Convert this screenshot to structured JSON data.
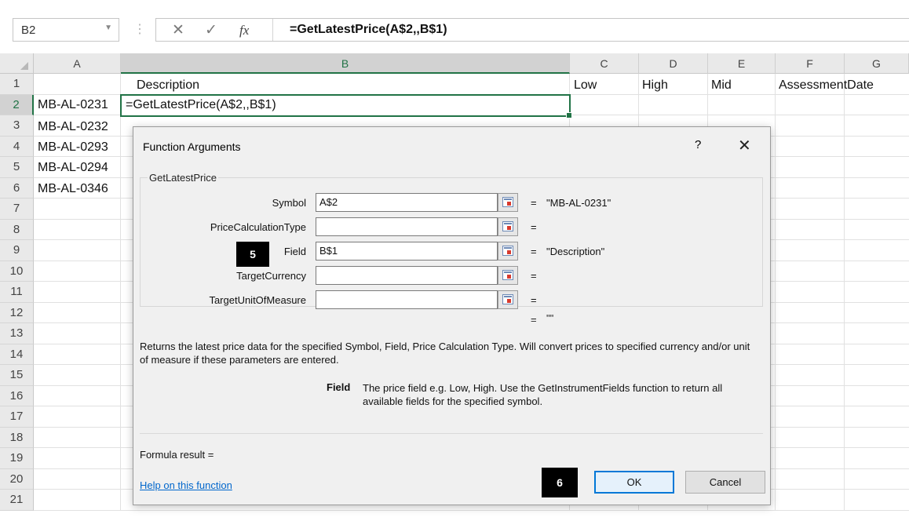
{
  "formula_bar": {
    "name_box": "B2",
    "cancel_icon": "✕",
    "enter_icon": "✓",
    "fx_icon": "fx",
    "formula": "=GetLatestPrice(A$2,,B$1)"
  },
  "sheet": {
    "columns": [
      "A",
      "B",
      "C",
      "D",
      "E",
      "F",
      "G"
    ],
    "selected_column": "B",
    "rows": [
      "1",
      "2",
      "3",
      "4",
      "5",
      "6",
      "7",
      "8",
      "9",
      "10",
      "11",
      "12",
      "13",
      "14",
      "15",
      "16",
      "17",
      "18",
      "19",
      "20",
      "21"
    ],
    "selected_row": "2",
    "header_row": {
      "B": "Description",
      "C": "Low",
      "D": "High",
      "E": "Mid",
      "F": "AssessmentDate"
    },
    "symbols": [
      "MB-AL-0231",
      "MB-AL-0232",
      "MB-AL-0293",
      "MB-AL-0294",
      "MB-AL-0346"
    ],
    "active_cell_text": "=GetLatestPrice(A$2,,B$1)",
    "grid_line_color": "#e1e1e1",
    "selection_color": "#217346"
  },
  "dialog": {
    "title": "Function Arguments",
    "help_icon": "?",
    "close_icon": "✕",
    "function_name": "GetLatestPrice",
    "args": [
      {
        "label": "Symbol",
        "value": "A$2",
        "result": "\"MB-AL-0231\""
      },
      {
        "label": "PriceCalculationType",
        "value": "",
        "result": ""
      },
      {
        "label": "Field",
        "value": "B$1",
        "result": "\"Description\""
      },
      {
        "label": "TargetCurrency",
        "value": "",
        "result": ""
      },
      {
        "label": "TargetUnitOfMeasure",
        "value": "",
        "result": ""
      }
    ],
    "eq_sign": "=",
    "overall_result": "\"\"",
    "description": "Returns the latest price data for the specified Symbol, Field, Price Calculation Type. Will convert prices to specified currency and/or unit of measure if these parameters are entered.",
    "field_name": "Field",
    "field_description": "The price field e.g. Low, High. Use the GetInstrumentFields function to return all available fields for the specified symbol.",
    "formula_result_label": "Formula result =",
    "help_link": "Help on this function",
    "ok_label": "OK",
    "cancel_label": "Cancel",
    "accent_color": "#0078d7"
  },
  "markers": {
    "step5": "5",
    "step6": "6"
  }
}
